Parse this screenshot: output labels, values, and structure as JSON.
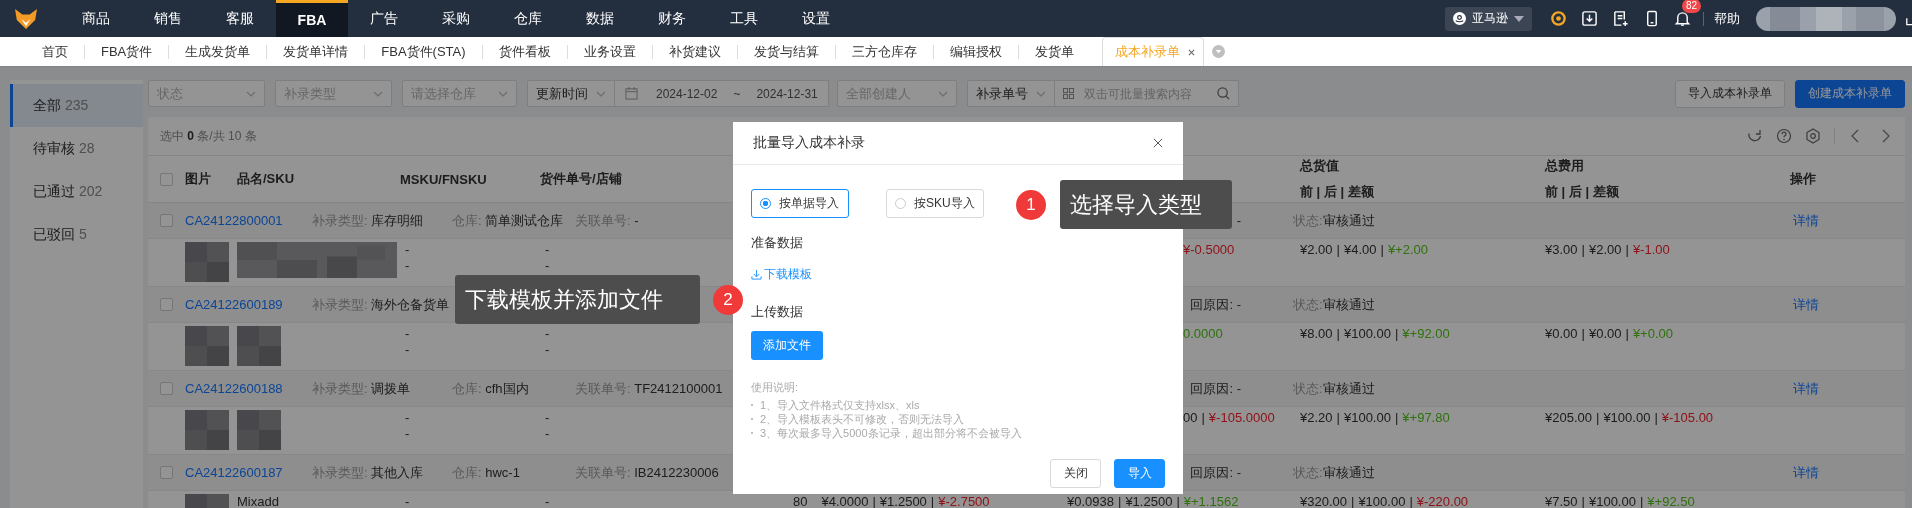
{
  "top_nav": {
    "items": [
      {
        "label": "商品",
        "selected": false
      },
      {
        "label": "销售",
        "selected": false
      },
      {
        "label": "客服",
        "selected": false
      },
      {
        "label": "FBA",
        "selected": true
      },
      {
        "label": "广告",
        "selected": false
      },
      {
        "label": "采购",
        "selected": false
      },
      {
        "label": "仓库",
        "selected": false
      },
      {
        "label": "数据",
        "selected": false
      },
      {
        "label": "财务",
        "selected": false
      },
      {
        "label": "工具",
        "selected": false
      },
      {
        "label": "设置",
        "selected": false
      }
    ],
    "platform": "亚马逊",
    "notifications": "82",
    "help": "帮助"
  },
  "tabs": [
    {
      "label": "首页",
      "selected": false
    },
    {
      "label": "FBA货件",
      "selected": false
    },
    {
      "label": "生成发货单",
      "selected": false
    },
    {
      "label": "发货单详情",
      "selected": false
    },
    {
      "label": "FBA货件(STA)",
      "selected": false
    },
    {
      "label": "货件看板",
      "selected": false
    },
    {
      "label": "业务设置",
      "selected": false
    },
    {
      "label": "补货建议",
      "selected": false
    },
    {
      "label": "发货与结算",
      "selected": false
    },
    {
      "label": "三方仓库存",
      "selected": false
    },
    {
      "label": "编辑授权",
      "selected": false
    },
    {
      "label": "发货单",
      "selected": false
    },
    {
      "label": "成本补录单",
      "selected": true
    }
  ],
  "sidebar": {
    "items": [
      {
        "label": "全部",
        "count": "235",
        "selected": true
      },
      {
        "label": "待审核",
        "count": "28",
        "selected": false
      },
      {
        "label": "已通过",
        "count": "202",
        "selected": false
      },
      {
        "label": "已驳回",
        "count": "5",
        "selected": false
      }
    ]
  },
  "filters": {
    "status": {
      "placeholder": "状态"
    },
    "type": {
      "placeholder": "补录类型"
    },
    "warehouse": {
      "placeholder": "请选择仓库"
    },
    "time_field": "更新时间",
    "date_start": "2024-12-02",
    "date_sep": "~",
    "date_end": "2024-12-31",
    "creator": {
      "placeholder": "全部创建人"
    },
    "search_field": "补录单号",
    "search": {
      "placeholder": "双击可批量搜索内容"
    }
  },
  "actions": [
    {
      "label": "导入成本补录单",
      "kind": "default"
    },
    {
      "label": "创建成本补录单",
      "kind": "primary"
    }
  ],
  "table": {
    "summary": "选中 **0** 条/共 10 条",
    "value_separator": "|",
    "select_all": {
      "checked": false
    },
    "columns": [
      "图片",
      "品名/SKU",
      "MSKU/FNSKU",
      "货件单号/店铺"
    ],
    "value_column": {
      "title": "总货值",
      "sub": "前 | 后 | 差额"
    },
    "fee_column": {
      "title": "总费用",
      "sub": "前 | 后 | 差额"
    },
    "ops_column": "操作",
    "rows": [
      {
        "checked": false,
        "order_no": "CA24122800001",
        "type": {
          "label": "补录类型:",
          "value": "库存明细"
        },
        "warehouse": {
          "label": "仓库:",
          "value": "简单测试仓库"
        },
        "link": {
          "label": "关联单号:",
          "value": "-"
        },
        "reason": "-",
        "status_label": "状态:",
        "status": "审核通过",
        "action": "详情",
        "detail": {
          "picture": {
            "kind": "picture"
          },
          "name_blurred": true,
          "msku": [
            "-",
            "-"
          ],
          "shipment": [
            "-",
            "-"
          ],
          "covered": [
            {
              "text": "¥-0.5000",
              "gain": false
            }
          ],
          "total_value": [
            {
              "text": "¥2.00"
            },
            {
              "text": "¥4.00"
            },
            {
              "text": "¥+2.00",
              "gain": true
            }
          ],
          "total_fee": [
            {
              "text": "¥3.00"
            },
            {
              "text": "¥2.00"
            },
            {
              "text": "¥-1.00",
              "gain": false
            }
          ]
        }
      },
      {
        "checked": false,
        "order_no": "CA24122600189",
        "type": {
          "label": "补录类型:",
          "value": "海外仓备货单"
        },
        "reason": "回原因: -",
        "status_label": "状态:",
        "status": "审核通过",
        "action": "详情",
        "detail": {
          "picture": {
            "kind": "picture"
          },
          "name_blurred": true,
          "msku": [
            "-",
            "-"
          ],
          "shipment": [
            "-",
            "-"
          ],
          "covered": [
            {
              "text": "0.0000",
              "gain": true
            }
          ],
          "total_value": [
            {
              "text": "¥8.00"
            },
            {
              "text": "¥100.00"
            },
            {
              "text": "¥+92.00",
              "gain": true
            }
          ],
          "total_fee": [
            {
              "text": "¥0.00"
            },
            {
              "text": "¥0.00"
            },
            {
              "text": "¥+0.00",
              "gain": true
            }
          ]
        }
      },
      {
        "checked": false,
        "order_no": "CA24122600188",
        "type": {
          "label": "补录类型:",
          "value": "调拨单"
        },
        "warehouse": {
          "label": "仓库:",
          "value": "cfh国内"
        },
        "link": {
          "label": "关联单号:",
          "value": "TF2412100001"
        },
        "reason": "回原因: -",
        "status_label": "状态:",
        "status": "审核通过",
        "action": "详情",
        "detail": {
          "picture": {
            "kind": "picture"
          },
          "name_blurred": true,
          "msku": [
            "-",
            "-"
          ],
          "shipment": [
            "-",
            "-"
          ],
          "covered": [
            {
              "text": "00"
            },
            {
              "text": "¥-105.0000",
              "gain": false
            }
          ],
          "total_value": [
            {
              "text": "¥2.20"
            },
            {
              "text": "¥100.00"
            },
            {
              "text": "¥+97.80",
              "gain": true
            }
          ],
          "total_fee": [
            {
              "text": "¥205.00"
            },
            {
              "text": "¥100.00"
            },
            {
              "text": "¥-105.00",
              "gain": false
            }
          ]
        }
      },
      {
        "checked": false,
        "order_no": "CA24122600187",
        "type": {
          "label": "补录类型:",
          "value": "其他入库"
        },
        "warehouse": {
          "label": "仓库:",
          "value": "hwc-1"
        },
        "link": {
          "label": "关联单号:",
          "value": "IB2412230006"
        },
        "reason": "回原因: -",
        "status_label": "状态:",
        "status": "审核通过",
        "action": "详情",
        "detail": {
          "picture": {
            "kind": "picture"
          },
          "name_blurred": false,
          "name": "Mixadd",
          "msku": [
            "-"
          ],
          "shipment": [
            "-"
          ],
          "qty": "80",
          "unit_cost": [
            {
              "text": "¥4.0000"
            },
            {
              "text": "¥1.2500"
            },
            {
              "text": "¥-2.7500",
              "gain": false
            }
          ],
          "unit_value": [
            {
              "text": "¥0.0938"
            },
            {
              "text": "¥1.2500"
            },
            {
              "text": "¥+1.1562",
              "gain": true
            }
          ],
          "total_value": [
            {
              "text": "¥320.00"
            },
            {
              "text": "¥100.00"
            },
            {
              "text": "¥-220.00",
              "gain": false
            }
          ],
          "total_fee": [
            {
              "text": "¥7.50"
            },
            {
              "text": "¥100.00"
            },
            {
              "text": "¥+92.50",
              "gain": true
            }
          ]
        }
      }
    ]
  },
  "modal": {
    "title": "批量导入成本补录",
    "options": [
      {
        "label": "按单据导入",
        "selected": true
      },
      {
        "label": "按SKU导入",
        "selected": false
      }
    ],
    "prepare_label": "准备数据",
    "download_link": "下载模板",
    "upload_label": "上传数据",
    "upload_button": "添加文件",
    "instructions_title": "使用说明:",
    "instructions": [
      "1、导入文件格式仅支持xlsx、xls",
      "2、导入模板表头不可修改，否则无法导入",
      "3、每次最多导入5000条记录，超出部分将不会被导入"
    ],
    "buttons": [
      {
        "label": "关闭",
        "kind": "default"
      },
      {
        "label": "导入",
        "kind": "primary"
      }
    ]
  },
  "guide_tips": [
    {
      "number": "1",
      "text": "选择导入类型"
    },
    {
      "number": "2",
      "text": "下载模板并添加文件"
    }
  ]
}
